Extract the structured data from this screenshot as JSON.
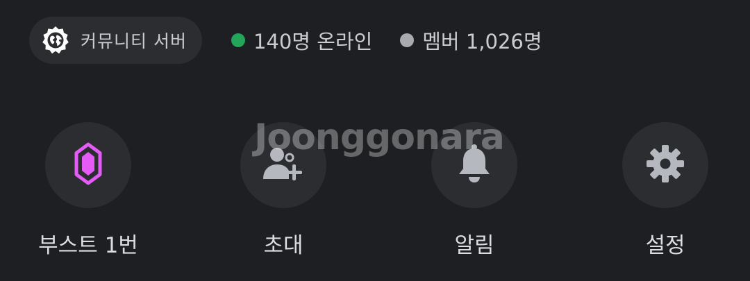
{
  "server": {
    "name": "커뮤니티 서버",
    "badge_icon": "globe-badge-icon"
  },
  "stats": {
    "online_text": "140명 온라인",
    "online_color": "#23a55a",
    "members_text": "멤버 1,026명",
    "members_color": "#a8aab0"
  },
  "actions": [
    {
      "label": "부스트 1번",
      "icon": "boost-gem-icon",
      "color": "#e45bf5"
    },
    {
      "label": "초대",
      "icon": "add-friend-icon",
      "color": "#b5b9bf"
    },
    {
      "label": "알림",
      "icon": "bell-icon",
      "color": "#b5b9bf"
    },
    {
      "label": "설정",
      "icon": "gear-icon",
      "color": "#b5b9bf"
    }
  ],
  "watermark": "Joonggonara"
}
